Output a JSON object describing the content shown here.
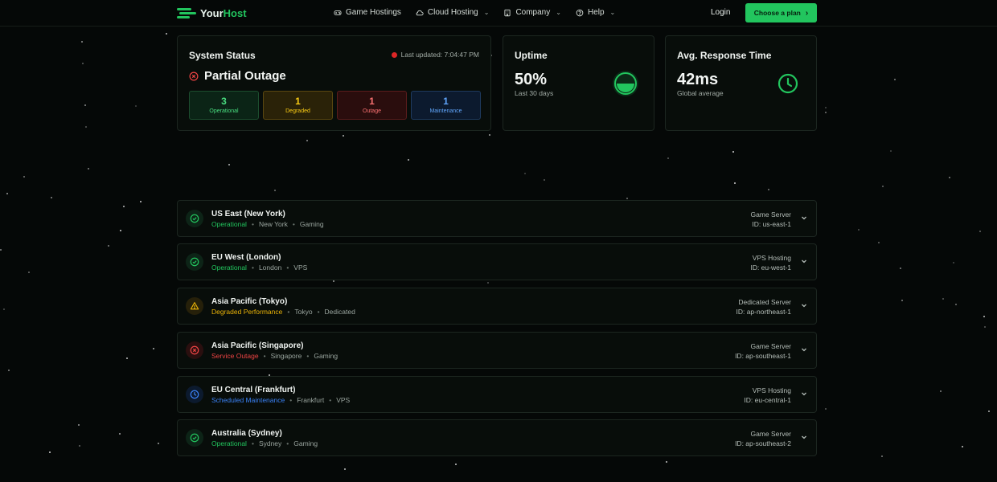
{
  "nav": {
    "brand_your": "Your",
    "brand_host": "Host",
    "items": [
      {
        "label": "Game Hostings",
        "icon": "gamepad-icon"
      },
      {
        "label": "Cloud Hosting",
        "icon": "cloud-icon"
      },
      {
        "label": "Company",
        "icon": "building-icon"
      },
      {
        "label": "Help",
        "icon": "help-circle-icon"
      }
    ],
    "login": "Login",
    "cta": "Choose a plan"
  },
  "status": {
    "title": "System Status",
    "updated": "Last updated: 7:04:47 PM",
    "overall": "Partial Outage",
    "counts": [
      {
        "n": "3",
        "label": "Operational"
      },
      {
        "n": "1",
        "label": "Degraded"
      },
      {
        "n": "1",
        "label": "Outage"
      },
      {
        "n": "1",
        "label": "Maintenance"
      }
    ]
  },
  "uptime": {
    "title": "Uptime",
    "value": "50%",
    "sub": "Last 30 days",
    "fraction": 0.5
  },
  "response": {
    "title": "Avg. Response Time",
    "value": "42ms",
    "sub": "Global average"
  },
  "servers": [
    {
      "name": "US East (New York)",
      "status": "Operational",
      "location": "New York",
      "category": "Gaming",
      "type": "Game Server",
      "id": "ID: us-east-1"
    },
    {
      "name": "EU West (London)",
      "status": "Operational",
      "location": "London",
      "category": "VPS",
      "type": "VPS Hosting",
      "id": "ID: eu-west-1"
    },
    {
      "name": "Asia Pacific (Tokyo)",
      "status": "Degraded Performance",
      "location": "Tokyo",
      "category": "Dedicated",
      "type": "Dedicated Server",
      "id": "ID: ap-northeast-1"
    },
    {
      "name": "Asia Pacific (Singapore)",
      "status": "Service Outage",
      "location": "Singapore",
      "category": "Gaming",
      "type": "Game Server",
      "id": "ID: ap-southeast-1"
    },
    {
      "name": "EU Central (Frankfurt)",
      "status": "Scheduled Maintenance",
      "location": "Frankfurt",
      "category": "VPS",
      "type": "VPS Hosting",
      "id": "ID: eu-central-1"
    },
    {
      "name": "Australia (Sydney)",
      "status": "Operational",
      "location": "Sydney",
      "category": "Gaming",
      "type": "Game Server",
      "id": "ID: ap-southeast-2"
    }
  ],
  "colors": {
    "accent": "#22c55e",
    "operational": "#22c55e",
    "degraded": "#eab308",
    "outage": "#ef4444",
    "maintenance": "#3b82f6"
  }
}
